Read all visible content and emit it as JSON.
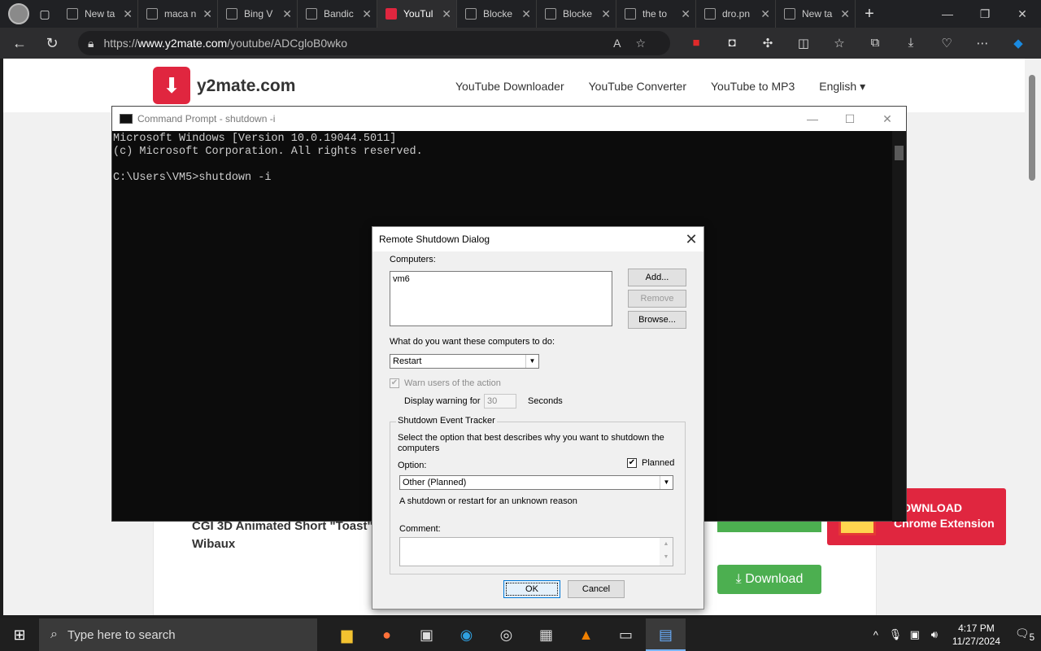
{
  "browser": {
    "tabs": [
      {
        "label": "New ta",
        "active": false
      },
      {
        "label": "maca n",
        "active": false
      },
      {
        "label": "Bing V",
        "active": false
      },
      {
        "label": "Bandic",
        "active": false
      },
      {
        "label": "YouTul",
        "active": true
      },
      {
        "label": "Blocke",
        "active": false
      },
      {
        "label": "Blocke",
        "active": false
      },
      {
        "label": "the to",
        "active": false
      },
      {
        "label": "dro.pn",
        "active": false
      },
      {
        "label": "New ta",
        "active": false
      }
    ],
    "url_prefix": "https://",
    "url_domain": "www.y2mate.com",
    "url_path": "/youtube/ADCgloB0wko"
  },
  "site": {
    "name": "y2mate.com",
    "nav": [
      "YouTube Downloader",
      "YouTube Converter",
      "YouTube to MP3",
      "English ▾"
    ],
    "video_title": "CGI 3D Animated Short \"Toast\" Wibaux",
    "download_label": "Download",
    "chrome_ext_line1": "DOWNLOAD",
    "chrome_ext_line2": "Chrome Extension"
  },
  "cmd": {
    "title": "Command Prompt - shutdown  -i",
    "output": "Microsoft Windows [Version 10.0.19044.5011]\n(c) Microsoft Corporation. All rights reserved.\n\nC:\\Users\\VM5>shutdown -i"
  },
  "dialog": {
    "title": "Remote Shutdown Dialog",
    "computers_label": "Computers:",
    "computers": "vm6",
    "add_btn": "Add...",
    "remove_btn": "Remove",
    "browse_btn": "Browse...",
    "action_label": "What do you want these computers to do:",
    "action_value": "Restart",
    "warn_label": "Warn users of the action",
    "display_warning_label": "Display warning for",
    "warning_seconds": "30",
    "seconds_label": "Seconds",
    "tracker_label": "Shutdown Event Tracker",
    "tracker_desc": "Select the option that best describes why you want to shutdown the computers",
    "option_label": "Option:",
    "planned_label": "Planned",
    "option_value": "Other (Planned)",
    "reason_desc": "A shutdown or restart for an unknown reason",
    "comment_label": "Comment:",
    "ok_btn": "OK",
    "cancel_btn": "Cancel"
  },
  "taskbar": {
    "search_placeholder": "Type here to search",
    "time": "4:17 PM",
    "date": "11/27/2024",
    "notif_count": "5"
  }
}
